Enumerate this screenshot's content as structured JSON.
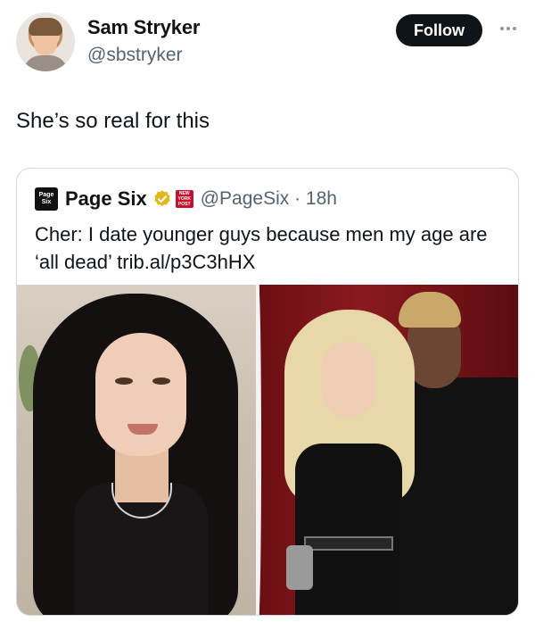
{
  "post": {
    "author_name": "Sam Stryker",
    "author_handle": "@sbstryker",
    "follow_label": "Follow",
    "text": "She’s so real for this"
  },
  "quote": {
    "logo_text": "Page Six",
    "source_name": "Page Six",
    "badge_text": "NEW YORK POST",
    "handle_time": "@PageSix · 18h",
    "text": "Cher: I date younger guys because men my age are ‘all dead’ trib.al/p3C3hHX"
  },
  "colors": {
    "follow_bg": "#0f1419",
    "verified": "#e2b719",
    "badge": "#c8102e",
    "secondary_text": "#536471"
  }
}
